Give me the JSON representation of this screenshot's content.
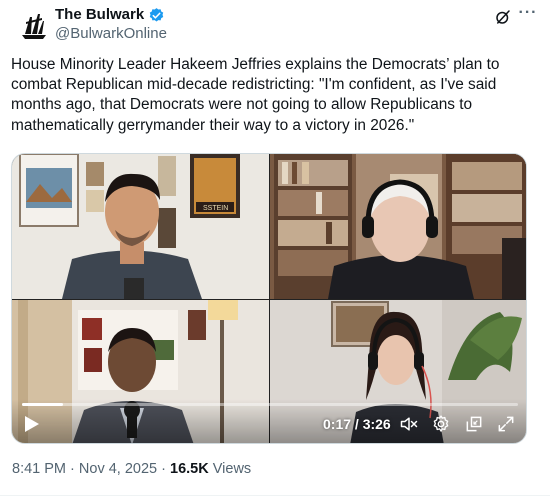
{
  "account": {
    "display_name": "The Bulwark",
    "handle": "@BulwarkOnline",
    "verified_color": "#1d9bf0"
  },
  "header_icons": [
    "grok-icon",
    "more-icon"
  ],
  "tweet": {
    "text": "House Minority Leader Hakeem Jeffries explains the Democrats’ plan to combat Republican mid-decade redistricting: \"I'm confident, as I've said months ago, that Democrats were not going to allow Republicans to mathematically gerrymander their way to a victory in 2026.\""
  },
  "video": {
    "time_display": "0:17 / 3:26",
    "progress_fraction": 0.083,
    "poster_text": "SSTEIN",
    "controls": [
      "play-icon",
      "mute-icon",
      "settings-icon",
      "fullscreen-icon",
      "expand-icon"
    ]
  },
  "meta": {
    "time": "8:41 PM",
    "separator": "·",
    "date": "Nov 4, 2025",
    "views_count": "16.5K",
    "views_label": "Views"
  }
}
